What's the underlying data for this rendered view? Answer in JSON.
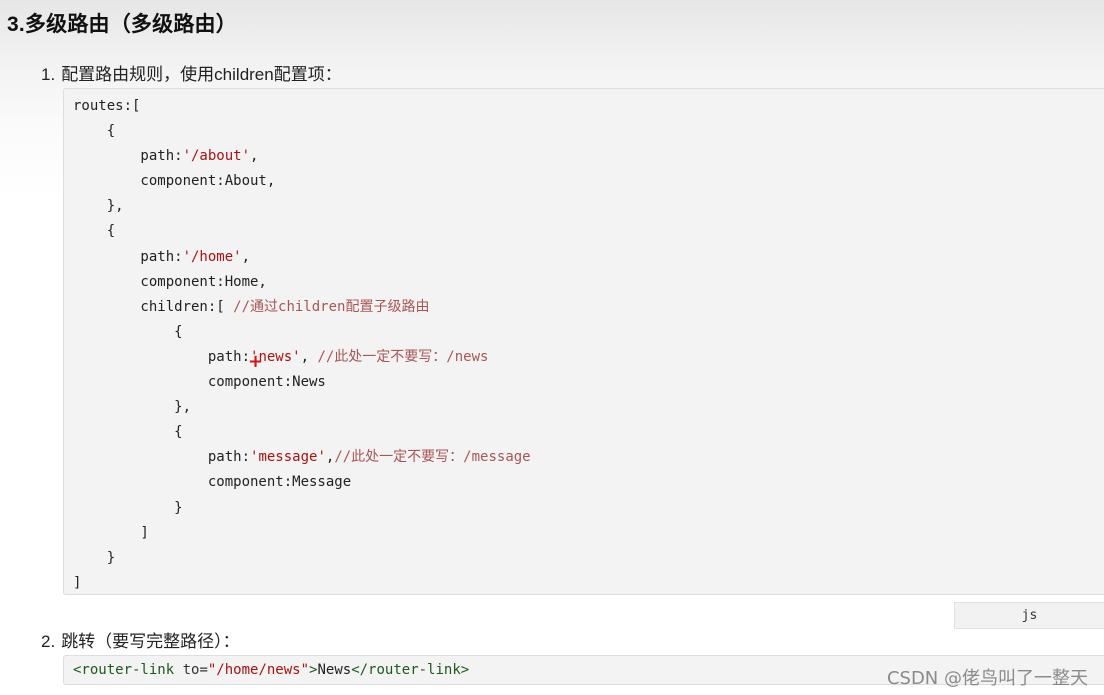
{
  "heading": "3.多级路由（多级路由）",
  "items": [
    {
      "num": "1.",
      "text": "配置路由规则，使用children配置项："
    },
    {
      "num": "2.",
      "text": "跳转（要写完整路径）："
    }
  ],
  "code": {
    "l1": "routes:[",
    "l2": "    {",
    "l3a": "        path:",
    "l3b": "'/about'",
    "l3c": ",",
    "l4": "        component:About,",
    "l5": "    },",
    "l6": "    {",
    "l7a": "        path:",
    "l7b": "'/home'",
    "l7c": ",",
    "l8": "        component:Home,",
    "l9a": "        children:[ ",
    "l9b": "//通过children配置子级路由",
    "l10": "            {",
    "l11a": "                path:",
    "l11b": "'news'",
    "l11c": ", ",
    "l11d": "//此处一定不要写：/news",
    "l12": "                component:News",
    "l13": "            },",
    "l14": "            {",
    "l15a": "                path:",
    "l15b": "'message'",
    "l15c": ",",
    "l15d": "//此处一定不要写：/message",
    "l16": "                component:Message",
    "l17": "            }",
    "l18": "        ]",
    "l19": "    }",
    "l20": "]"
  },
  "lang_badge": "js",
  "code2": {
    "tag_open": "<router-link",
    "attr": " to=",
    "value": "\"/home/news\"",
    "tag_close_open": ">",
    "text": "News",
    "tag_end": "</router-link>"
  },
  "cursor_glyph": "+",
  "watermark": "CSDN @佬鸟叫了一整天"
}
